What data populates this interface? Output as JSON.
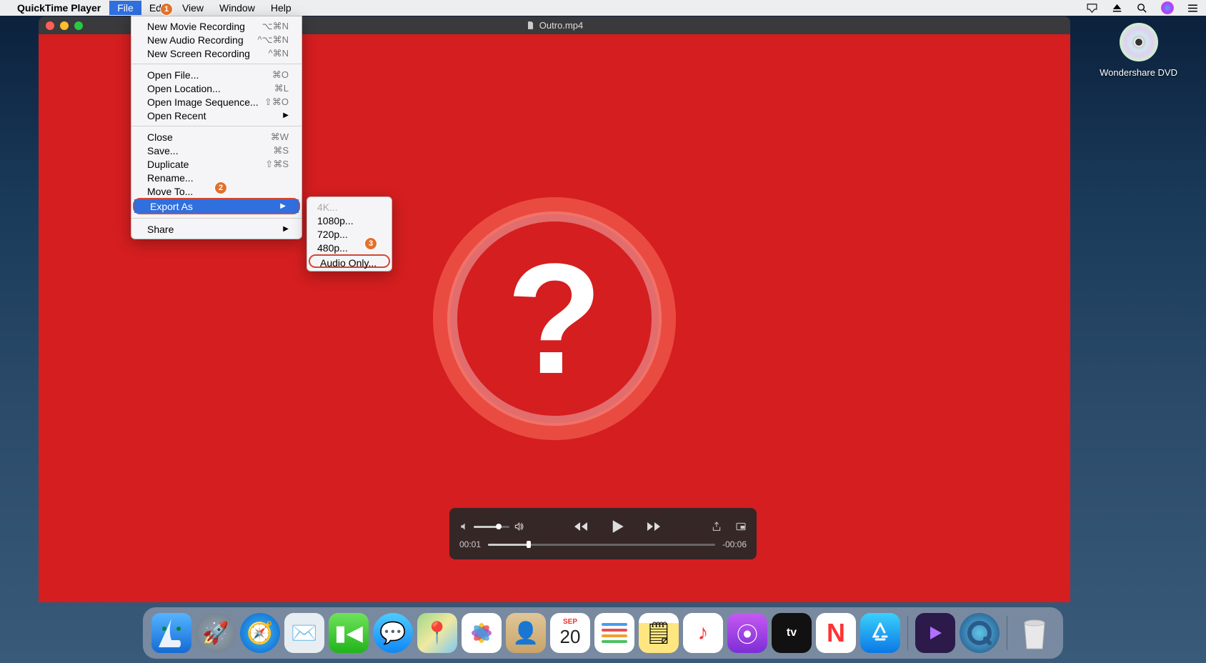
{
  "menubar": {
    "app_name": "QuickTime Player",
    "items": [
      "File",
      "Edit",
      "View",
      "Window",
      "Help"
    ],
    "active": "File"
  },
  "status_icons": [
    "airplay-icon",
    "eject-icon",
    "search-icon",
    "siri-icon",
    "list-icon"
  ],
  "file_menu": {
    "groups": [
      [
        {
          "label": "New Movie Recording",
          "shortcut": "⌥⌘N"
        },
        {
          "label": "New Audio Recording",
          "shortcut": "^⌥⌘N"
        },
        {
          "label": "New Screen Recording",
          "shortcut": "^⌘N"
        }
      ],
      [
        {
          "label": "Open File...",
          "shortcut": "⌘O"
        },
        {
          "label": "Open Location...",
          "shortcut": "⌘L"
        },
        {
          "label": "Open Image Sequence...",
          "shortcut": "⇧⌘O"
        },
        {
          "label": "Open Recent",
          "shortcut": "",
          "submenu": true
        }
      ],
      [
        {
          "label": "Close",
          "shortcut": "⌘W"
        },
        {
          "label": "Save...",
          "shortcut": "⌘S"
        },
        {
          "label": "Duplicate",
          "shortcut": "⇧⌘S"
        },
        {
          "label": "Rename...",
          "shortcut": ""
        },
        {
          "label": "Move To...",
          "shortcut": ""
        },
        {
          "label": "Export As",
          "shortcut": "",
          "submenu": true,
          "selected": true
        }
      ],
      [
        {
          "label": "Share",
          "shortcut": "",
          "submenu": true
        }
      ]
    ]
  },
  "export_submenu": [
    {
      "label": "4K...",
      "disabled": true
    },
    {
      "label": "1080p..."
    },
    {
      "label": "720p..."
    },
    {
      "label": "480p..."
    },
    {
      "label": "Audio Only...",
      "highlighted": true
    }
  ],
  "window": {
    "title": "Outro.mp4"
  },
  "player": {
    "elapsed": "00:01",
    "remaining": "-00:06"
  },
  "desktop_icon": {
    "label": "Wondershare DVD"
  },
  "dock": [
    {
      "name": "finder-icon",
      "bg": "linear-gradient(#4aa3f0,#1b6fd2)",
      "glyph": "🙂"
    },
    {
      "name": "launchpad-icon",
      "bg": "#7d8a99",
      "glyph": "🚀"
    },
    {
      "name": "safari-icon",
      "bg": "linear-gradient(#3db0f7,#0561c9)",
      "glyph": "🧭"
    },
    {
      "name": "mail-icon",
      "bg": "#dfe6ec",
      "glyph": "✉️"
    },
    {
      "name": "facetime-icon",
      "bg": "linear-gradient(#6fe25a,#23b31c)",
      "glyph": "📹"
    },
    {
      "name": "messages-icon",
      "bg": "linear-gradient(#4ecbff,#1187f4)",
      "glyph": "💬"
    },
    {
      "name": "maps-icon",
      "bg": "#e8ece4",
      "glyph": "🗺️"
    },
    {
      "name": "photos-icon",
      "bg": "#fff",
      "glyph": "🌸"
    },
    {
      "name": "contacts-icon",
      "bg": "#d9b887",
      "glyph": "📒"
    },
    {
      "name": "calendar-icon",
      "bg": "#fff",
      "glyph": "📅"
    },
    {
      "name": "reminders-icon",
      "bg": "#fff",
      "glyph": "📝"
    },
    {
      "name": "notes-icon",
      "bg": "#fff3a0",
      "glyph": "🗒️"
    },
    {
      "name": "music-icon",
      "bg": "#fff",
      "glyph": "🎵"
    },
    {
      "name": "podcasts-icon",
      "bg": "linear-gradient(#c659f2,#7d2ed6)",
      "glyph": "🎙️"
    },
    {
      "name": "tv-icon",
      "bg": "#111",
      "glyph": "tv"
    },
    {
      "name": "news-icon",
      "bg": "#fff",
      "glyph": "📰"
    },
    {
      "name": "appstore-icon",
      "bg": "linear-gradient(#3bd0fb,#0a78e6)",
      "glyph": "A"
    }
  ],
  "dock_right": [
    {
      "name": "uniconverter-icon",
      "bg": "#2c1a4a",
      "glyph": "▶"
    },
    {
      "name": "quicktime-icon",
      "bg": "linear-gradient(#5fc3e8,#1a4b80)",
      "glyph": "Q"
    }
  ],
  "markers": {
    "m1": "1",
    "m2": "2",
    "m3": "3"
  },
  "calendar": {
    "month": "SEP",
    "day": "20"
  }
}
